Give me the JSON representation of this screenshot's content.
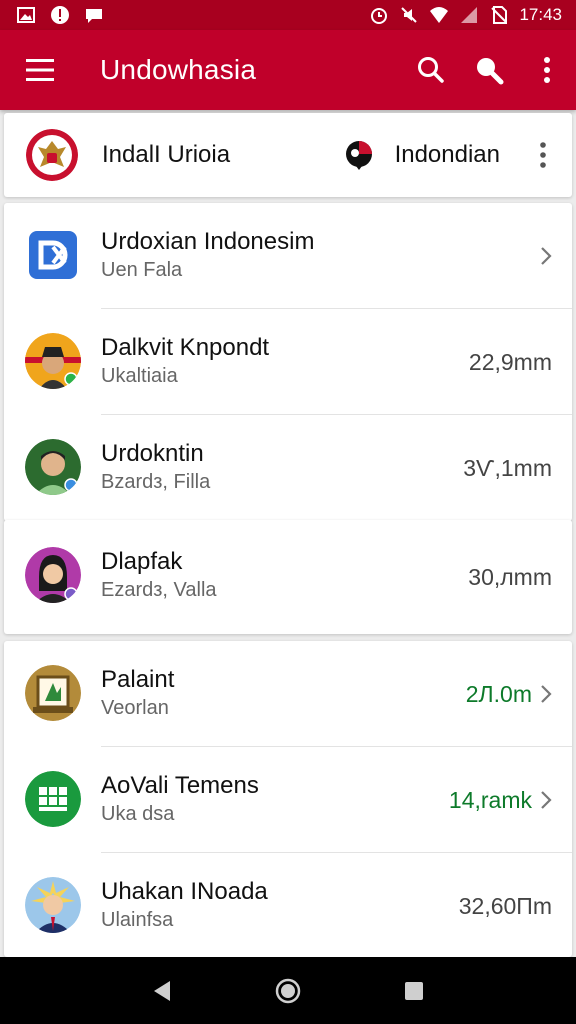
{
  "status_bar": {
    "time": "17:43",
    "left_icons": [
      "image-notification-icon",
      "alert-notification-icon",
      "chat-notification-icon"
    ],
    "right_icons": [
      "alarm-icon",
      "mute-icon",
      "wifi-icon",
      "signal-icon",
      "no-sim-icon"
    ]
  },
  "app_bar": {
    "title": "Undowhasia",
    "bg_color": "#c0002a"
  },
  "header_card": {
    "name": "IndalI Urioia",
    "language": "Indondian"
  },
  "lists": [
    {
      "items": [
        {
          "title": "Urdoxian Indonesim",
          "subtitle": "Uen Fala",
          "value": "",
          "chevron": true,
          "avatar": "app-logo-icon"
        },
        {
          "title": "Dalkvit Knpondt",
          "subtitle": "Ukaltiaia",
          "value": "22,9mm",
          "chevron": false,
          "avatar": "person-avatar"
        },
        {
          "title": "Urdokntin",
          "subtitle": "Bzardз, Filla",
          "value": "3Ѵ,1mm",
          "chevron": false,
          "avatar": "person-avatar"
        }
      ]
    },
    {
      "items": [
        {
          "title": "Dlapfak",
          "subtitle": "Ezardз, Valla",
          "value": "30,лmm",
          "chevron": false,
          "avatar": "person-avatar"
        }
      ]
    },
    {
      "items": [
        {
          "title": "Palaint",
          "subtitle": "Veorlan",
          "value": "2Л.0m",
          "chevron": true,
          "avatar": "painting-icon",
          "value_color": "green"
        },
        {
          "title": "AoVali Temens",
          "subtitle": "Uka dsa",
          "value": "14,ramk",
          "chevron": true,
          "avatar": "qr-logo-icon",
          "value_color": "green"
        },
        {
          "title": "Uhakan INoada",
          "subtitle": "Ulainfsa",
          "value": "32,60Пm",
          "chevron": false,
          "avatar": "person-avatar"
        }
      ]
    }
  ],
  "colors": {
    "accent": "#c0002a",
    "status_bar": "#a8001f",
    "green_value": "#0d7a2a"
  }
}
